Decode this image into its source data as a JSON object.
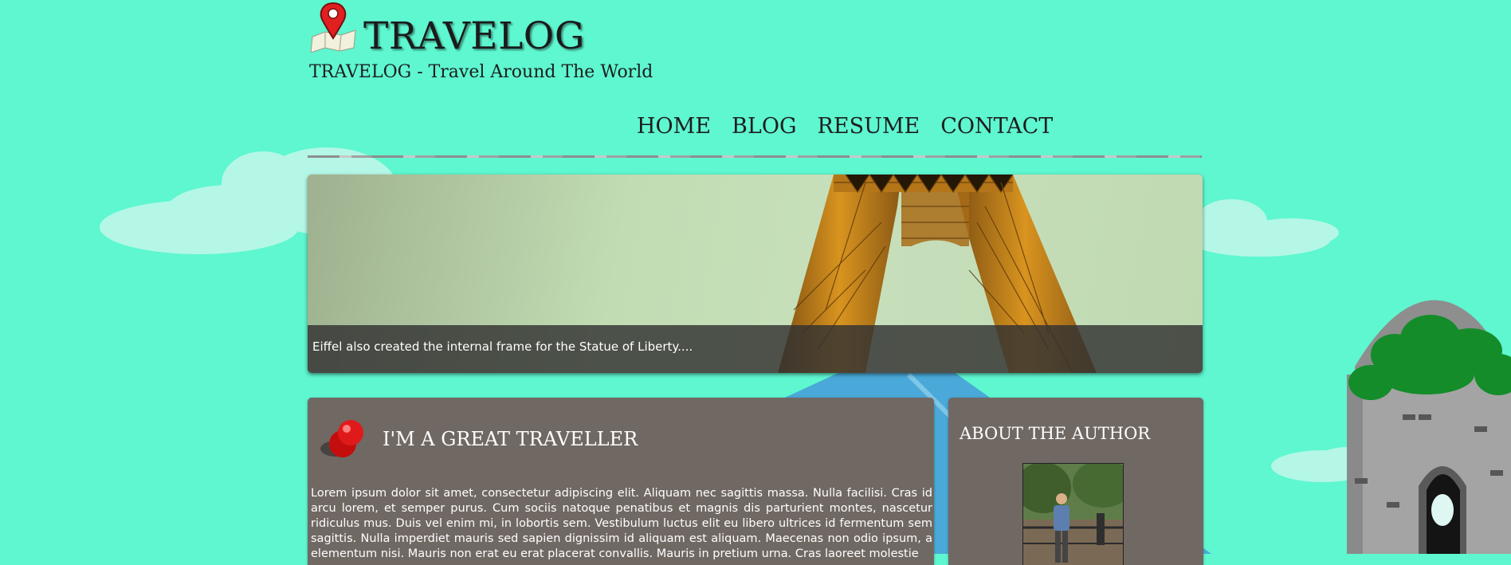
{
  "site": {
    "logo_text": "TRAVELOG",
    "tagline": "TRAVELOG - Travel Around The World"
  },
  "nav": {
    "items": [
      {
        "label": "HOME"
      },
      {
        "label": "BLOG"
      },
      {
        "label": "RESUME"
      },
      {
        "label": "CONTACT"
      }
    ]
  },
  "slider": {
    "caption": "Eiffel also created the internal frame for the Statue of Liberty...."
  },
  "post": {
    "title": "I'M A GREAT TRAVELLER",
    "body": "Lorem ipsum dolor sit amet, consectetur adipiscing elit. Aliquam nec sagittis massa. Nulla facilisi. Cras id arcu lorem, et semper purus. Cum sociis natoque penatibus et magnis dis parturient montes, nascetur ridiculus mus. Duis vel enim mi, in lobortis sem. Vestibulum luctus elit eu libero ultrices id fermentum sem sagittis. Nulla imperdiet mauris sed sapien dignissim id aliquam est aliquam. Maecenas non odio ipsum, a elementum nisi. Mauris non erat eu erat placerat convallis. Mauris in pretium urna. Cras laoreet molestie"
  },
  "sidebar": {
    "title": "ABOUT THE AUTHOR"
  },
  "colors": {
    "background": "#5ef7d0",
    "panel": "#706863",
    "caption_bar": "#323232",
    "text_dark": "#1d1d1d"
  }
}
